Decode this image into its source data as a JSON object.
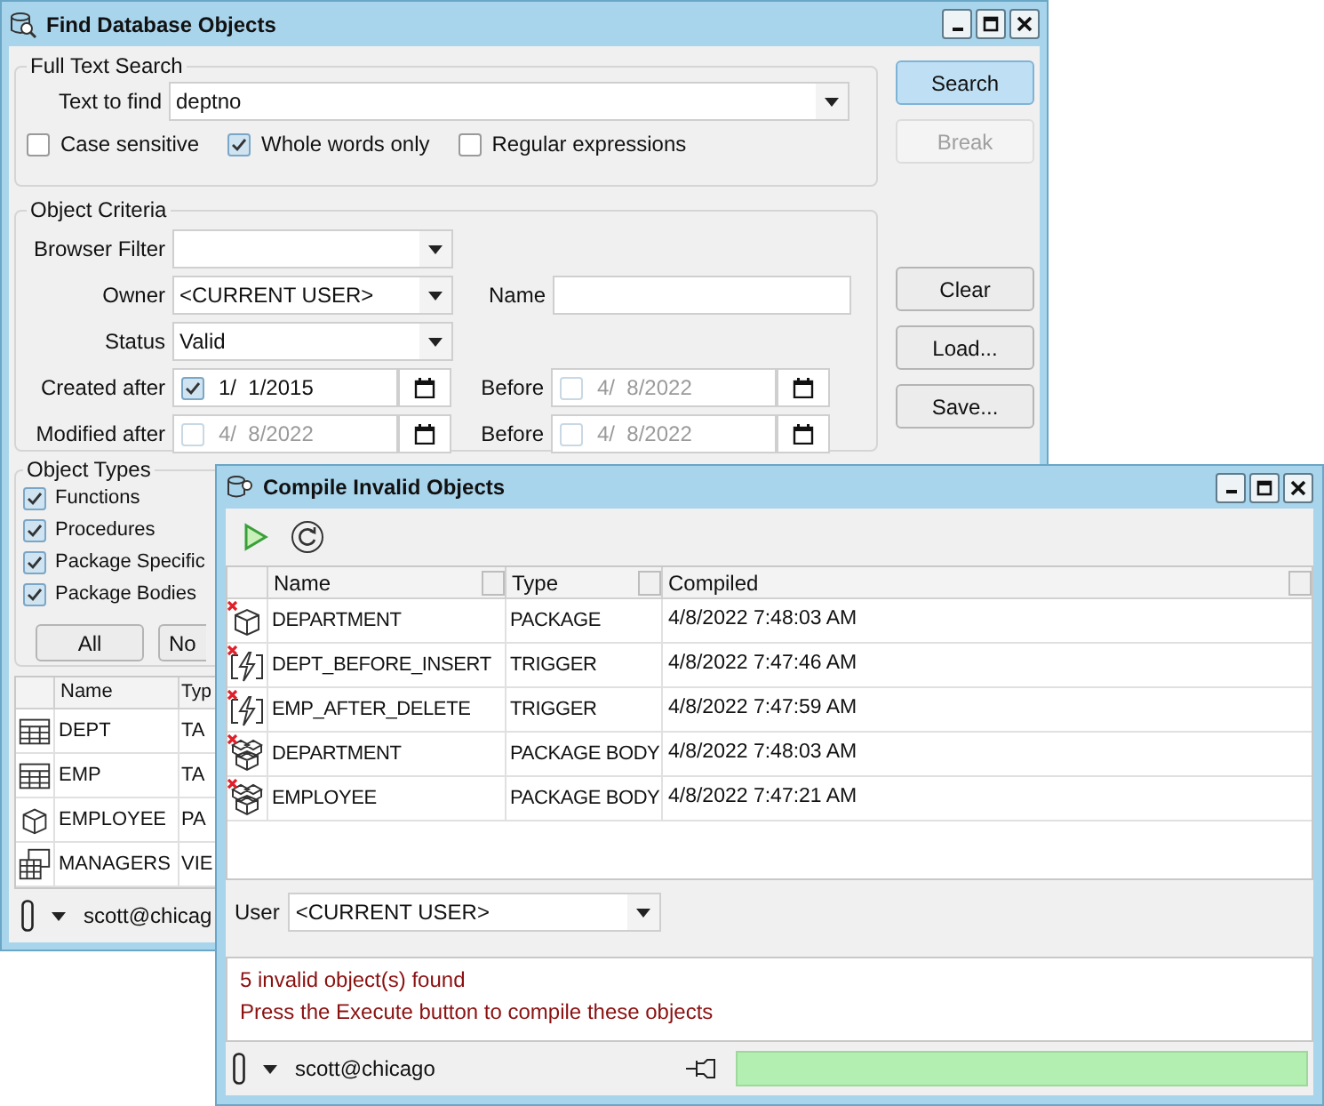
{
  "find_window": {
    "title": "Find Database Objects",
    "full_text_search": {
      "title": "Full Text Search",
      "text_to_find": {
        "label": "Text to find",
        "value": "deptno"
      },
      "options": [
        {
          "label": "Case sensitive",
          "checked": false
        },
        {
          "label": "Whole words only",
          "checked": true
        },
        {
          "label": "Regular expressions",
          "checked": false
        }
      ]
    },
    "buttons": [
      {
        "label": "Search",
        "highlighted": true,
        "disabled": false
      },
      {
        "label": "Break",
        "highlighted": false,
        "disabled": true
      }
    ],
    "lower_buttons": [
      {
        "label": "Clear",
        "highlighted": false,
        "disabled": false
      },
      {
        "label": "Load...",
        "highlighted": false,
        "disabled": false
      },
      {
        "label": "Save...",
        "highlighted": false,
        "disabled": false
      }
    ],
    "object_criteria": {
      "title": "Object Criteria",
      "browser_filter": {
        "label": "Browser Filter"
      },
      "owner": {
        "label": "Owner",
        "value": "<CURRENT USER>"
      },
      "name": {
        "label": "Name"
      },
      "status": {
        "label": "Status",
        "value": "Valid"
      },
      "dates": [
        {
          "label": "Created after",
          "checked": true,
          "value": "1/  1/2015",
          "before_label": "Before",
          "before_checked": false,
          "before_value": "4/  8/2022"
        },
        {
          "label": "Modified after",
          "checked": false,
          "value": "4/  8/2022",
          "before_label": "Before",
          "before_checked": false,
          "before_value": "4/  8/2022"
        }
      ]
    },
    "object_types": {
      "title": "Object Types",
      "items": [
        {
          "label": "Functions",
          "checked": true
        },
        {
          "label": "Procedures",
          "checked": true
        },
        {
          "label": "Package Specific",
          "checked": true
        },
        {
          "label": "Package Bodies",
          "checked": true
        }
      ],
      "buttons": [
        "All",
        "No"
      ]
    },
    "results": {
      "columns": [
        "Name",
        "Typ"
      ],
      "rows": [
        {
          "kind": "table",
          "name": "DEPT",
          "type": "TA"
        },
        {
          "kind": "table",
          "name": "EMP",
          "type": "TA"
        },
        {
          "kind": "package",
          "name": "EMPLOYEE",
          "type": "PA"
        },
        {
          "kind": "view",
          "name": "MANAGERS",
          "type": "VIE"
        }
      ]
    },
    "status_bar": {
      "connection": "scott@chicag"
    }
  },
  "compile_window": {
    "title": "Compile Invalid Objects",
    "table": {
      "columns": [
        "Name",
        "Type",
        "Compiled"
      ],
      "rows": [
        {
          "kind": "package",
          "name": "DEPARTMENT",
          "type": "PACKAGE",
          "compiled": "4/8/2022 7:48:03 AM"
        },
        {
          "kind": "trigger",
          "name": "DEPT_BEFORE_INSERT",
          "type": "TRIGGER",
          "compiled": "4/8/2022 7:47:46 AM"
        },
        {
          "kind": "trigger",
          "name": "EMP_AFTER_DELETE",
          "type": "TRIGGER",
          "compiled": "4/8/2022 7:47:59 AM"
        },
        {
          "kind": "package_body",
          "name": "DEPARTMENT",
          "type": "PACKAGE BODY",
          "compiled": "4/8/2022 7:48:03 AM"
        },
        {
          "kind": "package_body",
          "name": "EMPLOYEE",
          "type": "PACKAGE BODY",
          "compiled": "4/8/2022 7:47:21 AM"
        }
      ]
    },
    "user": {
      "label": "User",
      "value": "<CURRENT USER>"
    },
    "messages": [
      "5 invalid object(s) found",
      "Press the Execute button to compile these objects"
    ],
    "status_bar": {
      "connection": "scott@chicago",
      "level": 1
    }
  }
}
